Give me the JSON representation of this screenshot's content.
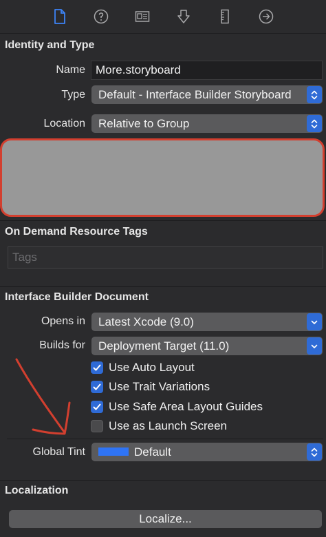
{
  "toolbar": {
    "icons": [
      "file-inspector-icon",
      "quick-help-icon",
      "identity-inspector-icon",
      "attributes-inspector-icon",
      "size-inspector-icon",
      "connections-inspector-icon"
    ]
  },
  "identity": {
    "title": "Identity and Type",
    "name_label": "Name",
    "name_value": "More.storyboard",
    "type_label": "Type",
    "type_value": "Default - Interface Builder Storyboard",
    "location_label": "Location",
    "location_value": "Relative to Group"
  },
  "odr": {
    "title": "On Demand Resource Tags",
    "tags_placeholder": "Tags"
  },
  "ibdoc": {
    "title": "Interface Builder Document",
    "opens_in_label": "Opens in",
    "opens_in_value": "Latest Xcode (9.0)",
    "builds_for_label": "Builds for",
    "builds_for_value": "Deployment Target (11.0)",
    "checks": [
      {
        "label": "Use Auto Layout",
        "checked": true
      },
      {
        "label": "Use Trait Variations",
        "checked": true
      },
      {
        "label": "Use Safe Area Layout Guides",
        "checked": true
      },
      {
        "label": "Use as Launch Screen",
        "checked": false
      }
    ],
    "global_tint_label": "Global Tint",
    "global_tint_value": "Default"
  },
  "localization": {
    "title": "Localization",
    "button_label": "Localize..."
  },
  "colors": {
    "accent": "#2f6bd6",
    "annotation_red": "#d23f2f",
    "tint_swatch": "#2f74f5"
  }
}
